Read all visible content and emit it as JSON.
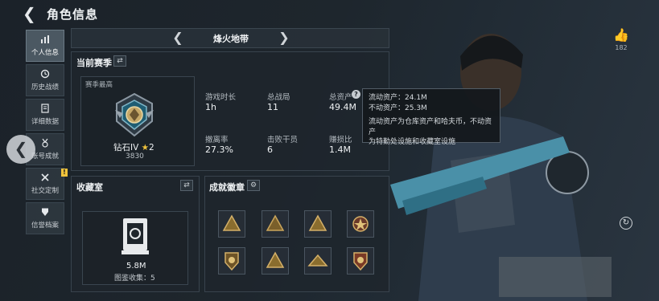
{
  "header": {
    "title": "角色信息"
  },
  "nav": {
    "items": [
      {
        "label": "个人信息",
        "active": true,
        "icon": "bar-chart-icon"
      },
      {
        "label": "历史战绩",
        "active": false,
        "icon": "history-icon"
      },
      {
        "label": "详细数据",
        "active": false,
        "icon": "document-icon"
      },
      {
        "label": "账号成就",
        "active": false,
        "icon": "medal-icon"
      },
      {
        "label": "社交定制",
        "active": false,
        "icon": "tools-icon"
      },
      {
        "label": "信誉档案",
        "active": false,
        "icon": "shield-icon"
      }
    ]
  },
  "season": {
    "map_name": "烽火地带",
    "section_title": "当前赛季",
    "best_label": "赛季最高",
    "rank_name": "钻石IV",
    "rank_stars": "2",
    "rank_points": "3830",
    "stats": [
      {
        "label": "游戏时长",
        "value": "1h"
      },
      {
        "label": "总战局",
        "value": "11"
      },
      {
        "label": "总资产",
        "value": "49.4M"
      },
      {
        "label": "撤离率",
        "value": "27.3%"
      },
      {
        "label": "击败干员",
        "value": "6"
      },
      {
        "label": "赚损比",
        "value": "1.4M"
      }
    ]
  },
  "tooltip": {
    "line1": "流动资产：24.1M",
    "line2": "不动资产：25.3M",
    "line3": "流动资产为仓库资产和哈夫币，不动资产",
    "line4": "为特勤处设施和收藏室设施"
  },
  "collection": {
    "title": "收藏室",
    "value": "5.8M",
    "collected_label": "图鉴收集：5"
  },
  "achievements": {
    "title": "成就徽章",
    "count": 8
  },
  "likes": {
    "count": "182"
  },
  "colors": {
    "accent_gold": "#f0c33c",
    "panel_bg": "#1e262d"
  }
}
